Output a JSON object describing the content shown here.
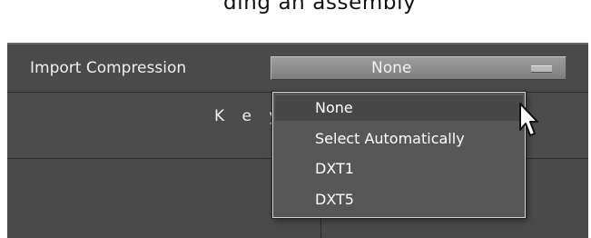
{
  "top_text": "ding an assembly",
  "import_compression": {
    "label": "Import Compression",
    "value": "None"
  },
  "key_column_label": "K e y",
  "dropdown": {
    "options": [
      "None",
      "Select Automatically",
      "DXT1",
      "DXT5"
    ],
    "selected": "None"
  },
  "icons": {
    "select_handle": "dropdown-handle-icon",
    "cursor": "mouse-pointer-icon"
  },
  "colors": {
    "panel_background": "#4a4a4a",
    "select_background": "#8d8d8d",
    "menu_background": "#575757",
    "menu_highlight": "#474747",
    "text": "#ffffff"
  }
}
